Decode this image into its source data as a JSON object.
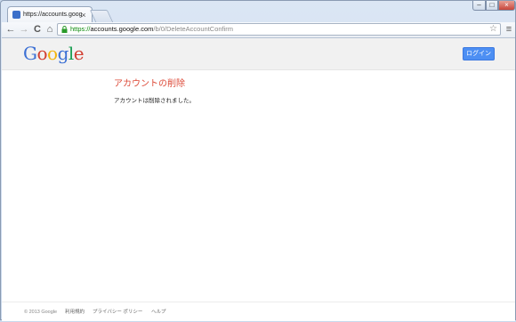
{
  "browser": {
    "tab_title": "https://accounts.google.co",
    "tab_close": "×",
    "url_scheme": "https://",
    "url_host": "accounts.google.com",
    "url_path": "/b/0/DeleteAccountConfirm",
    "window_min": "–",
    "window_max": "□",
    "window_close": "×"
  },
  "header": {
    "logo_letters": [
      "G",
      "o",
      "o",
      "g",
      "l",
      "e"
    ],
    "logo_colors": [
      "#3b6fd4",
      "#d23f31",
      "#f2b50f",
      "#3b6fd4",
      "#1a9e52",
      "#d23f31"
    ],
    "login_label": "ログイン"
  },
  "main": {
    "heading": "アカウントの削除",
    "message": "アカウントは削除されました。"
  },
  "footer": {
    "copyright": "© 2013 Google",
    "terms": "利用規約",
    "privacy": "プライバシー ポリシー",
    "help": "ヘルプ"
  },
  "icons": {
    "back": "←",
    "forward": "→",
    "reload": "C",
    "home": "⌂",
    "star": "☆",
    "menu": "≡"
  }
}
